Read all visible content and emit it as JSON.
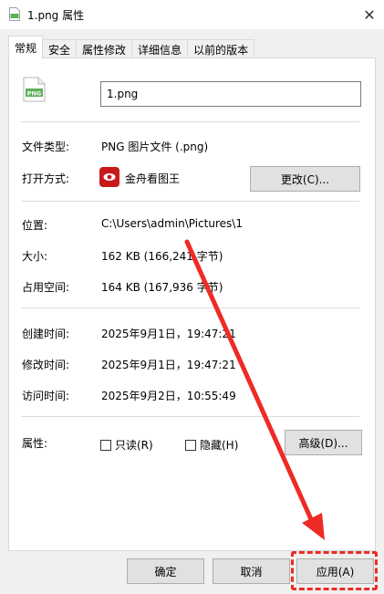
{
  "window": {
    "title": "1.png 属性",
    "close_glyph": "✕"
  },
  "tabs": [
    {
      "label": "常规",
      "active": true
    },
    {
      "label": "安全"
    },
    {
      "label": "属性修改"
    },
    {
      "label": "详细信息"
    },
    {
      "label": "以前的版本"
    }
  ],
  "file": {
    "name": "1.png",
    "icon_label": "PNG"
  },
  "type_section": {
    "file_type_label": "文件类型:",
    "file_type_value": "PNG 图片文件 (.png)",
    "open_with_label": "打开方式:",
    "open_with_value": "金舟看图王",
    "change_button": "更改(C)..."
  },
  "location_section": {
    "location_label": "位置:",
    "location_value": "C:\\Users\\admin\\Pictures\\1",
    "size_label": "大小:",
    "size_value": "162 KB (166,241 字节)",
    "disk_size_label": "占用空间:",
    "disk_size_value": "164 KB (167,936 字节)"
  },
  "time_section": {
    "created_label": "创建时间:",
    "created_value": "2025年9月1日，19:47:21",
    "modified_label": "修改时间:",
    "modified_value": "2025年9月1日，19:47:21",
    "accessed_label": "访问时间:",
    "accessed_value": "2025年9月2日，10:55:49"
  },
  "attributes": {
    "label": "属性:",
    "readonly_label": "只读(R)",
    "hidden_label": "隐藏(H)",
    "advanced_button": "高级(D)..."
  },
  "footer": {
    "ok_button": "确定",
    "cancel_button": "取消",
    "apply_button": "应用(A)"
  },
  "colors": {
    "annotation": "#ee2b24",
    "app_icon": "#c81a1a",
    "file_icon_green": "#5fae5a"
  },
  "icons": {
    "file": "png-file-icon",
    "app": "jinzhou-viewer-icon",
    "close": "close-icon"
  }
}
